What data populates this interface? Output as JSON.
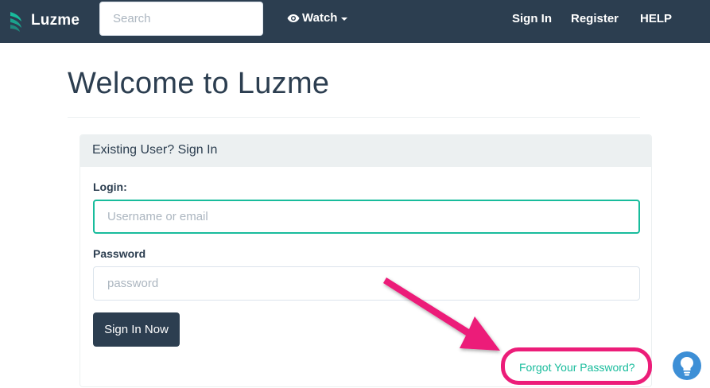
{
  "nav": {
    "brand": "Luzme",
    "search_placeholder": "Search",
    "watch_label": "Watch",
    "links": [
      "Sign In",
      "Register",
      "HELP"
    ]
  },
  "page": {
    "title": "Welcome to Luzme"
  },
  "login_panel": {
    "heading": "Existing User? Sign In",
    "login_label": "Login:",
    "login_placeholder": "Username or email",
    "password_label": "Password",
    "password_placeholder": "password",
    "submit_label": "Sign In Now",
    "forgot_label": "Forgot Your Password?"
  },
  "colors": {
    "navbar": "#2c3e50",
    "accent": "#18bc9c",
    "annotation": "#ec1d79",
    "help_icon": "#3d8fd6"
  },
  "icons": [
    "luzme-logo-icon",
    "eye-icon",
    "chevron-down-icon",
    "annotation-arrow",
    "help-lightbulb-icon"
  ]
}
